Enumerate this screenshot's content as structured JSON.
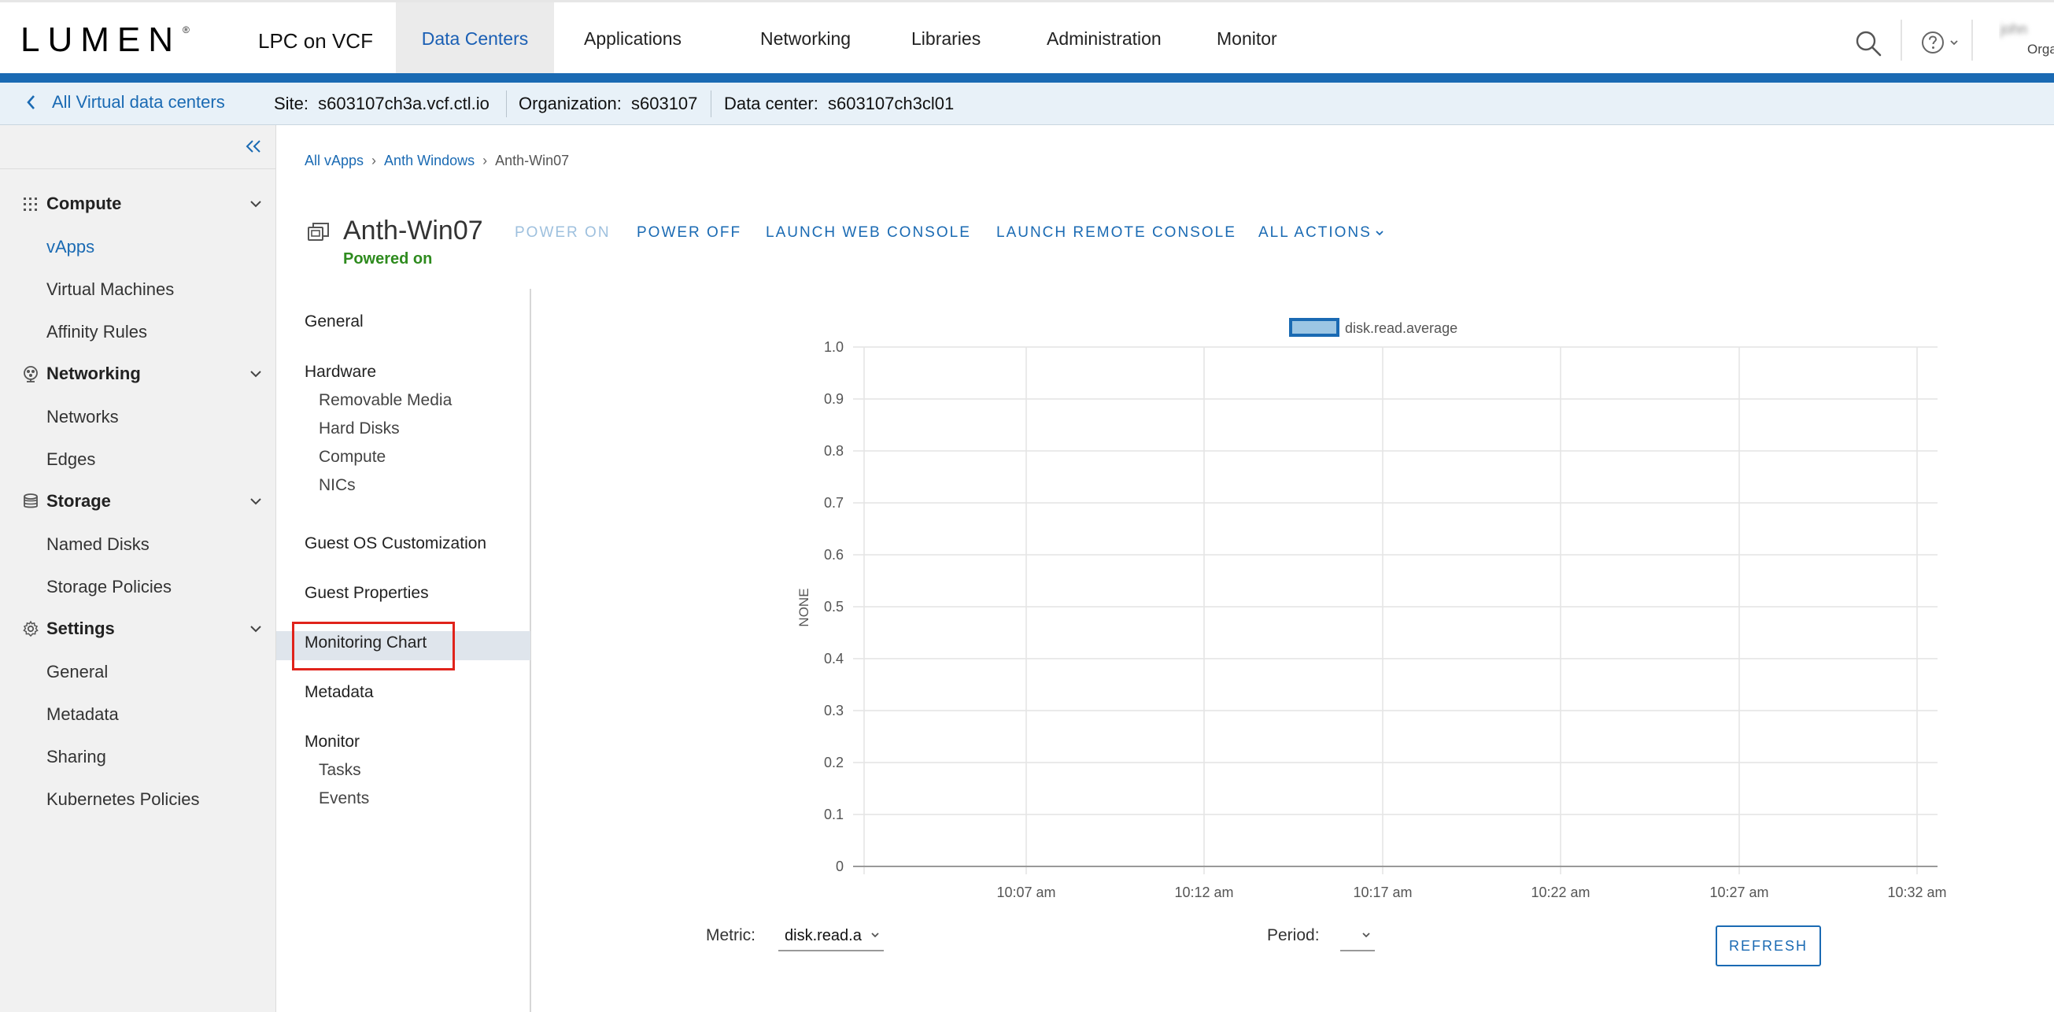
{
  "header": {
    "logo": "LUMEN",
    "logo_mark": "®",
    "app_title": "LPC on VCF",
    "nav": [
      {
        "label": "Data Centers",
        "active": true
      },
      {
        "label": "Applications"
      },
      {
        "label": "Networking"
      },
      {
        "label": "Libraries"
      },
      {
        "label": "Administration"
      },
      {
        "label": "Monitor"
      }
    ],
    "user_name": "john",
    "user_org": "Orga",
    "icons": {
      "search": "search-icon",
      "help": "help-icon"
    }
  },
  "context": {
    "back_label": "All Virtual data centers",
    "site_label": "Site:",
    "site_value": "s603107ch3a.vcf.ctl.io",
    "org_label": "Organization:",
    "org_value": "s603107",
    "dc_label": "Data center:",
    "dc_value": "s603107ch3cl01"
  },
  "sidebar": {
    "groups": [
      {
        "label": "Compute",
        "icon": "compute-grid-icon",
        "items": [
          "vApps",
          "Virtual Machines",
          "Affinity Rules"
        ]
      },
      {
        "label": "Networking",
        "icon": "network-icon",
        "items": [
          "Networks",
          "Edges"
        ]
      },
      {
        "label": "Storage",
        "icon": "database-icon",
        "items": [
          "Named Disks",
          "Storage Policies"
        ]
      },
      {
        "label": "Settings",
        "icon": "gear-icon",
        "items": [
          "General",
          "Metadata",
          "Sharing",
          "Kubernetes Policies"
        ]
      }
    ],
    "active_item": "vApps"
  },
  "breadcrumb": {
    "items": [
      "All vApps",
      "Anth Windows"
    ],
    "current": "Anth-Win07"
  },
  "vm": {
    "name": "Anth-Win07",
    "status": "Powered on",
    "status_color": "#2e8b1e"
  },
  "actions": {
    "power_on": "POWER ON",
    "power_off": "POWER OFF",
    "web_console": "LAUNCH WEB CONSOLE",
    "remote_console": "LAUNCH REMOTE CONSOLE",
    "all_actions": "ALL ACTIONS"
  },
  "subnav": {
    "general": "General",
    "hardware": "Hardware",
    "hardware_items": [
      "Removable Media",
      "Hard Disks",
      "Compute",
      "NICs"
    ],
    "guest_os": "Guest OS Customization",
    "guest_props": "Guest Properties",
    "monitoring": "Monitoring Chart",
    "metadata": "Metadata",
    "monitor": "Monitor",
    "monitor_items": [
      "Tasks",
      "Events"
    ],
    "active": "Monitoring Chart"
  },
  "chart_data": {
    "type": "line",
    "title": "",
    "xlabel": "",
    "ylabel": "NONE",
    "series": [
      {
        "name": "disk.read.average",
        "values": []
      }
    ],
    "x_ticks": [
      "10:07 am",
      "10:12 am",
      "10:17 am",
      "10:22 am",
      "10:27 am",
      "10:32 am"
    ],
    "y_ticks": [
      "0",
      "0.1",
      "0.2",
      "0.3",
      "0.4",
      "0.5",
      "0.6",
      "0.7",
      "0.8",
      "0.9",
      "1.0"
    ],
    "ylim": [
      0,
      1
    ],
    "grid": true,
    "legend_position": "top",
    "legend_color": "#9cc6e4",
    "legend_border": "#1a6ab3"
  },
  "controls": {
    "metric_label": "Metric:",
    "metric_value": "disk.read.a",
    "period_label": "Period:",
    "period_value": "",
    "refresh": "REFRESH"
  },
  "colors": {
    "accent": "#1a6ab3",
    "brand_bar": "#1a6ab3",
    "highlight": "#e0231b"
  }
}
